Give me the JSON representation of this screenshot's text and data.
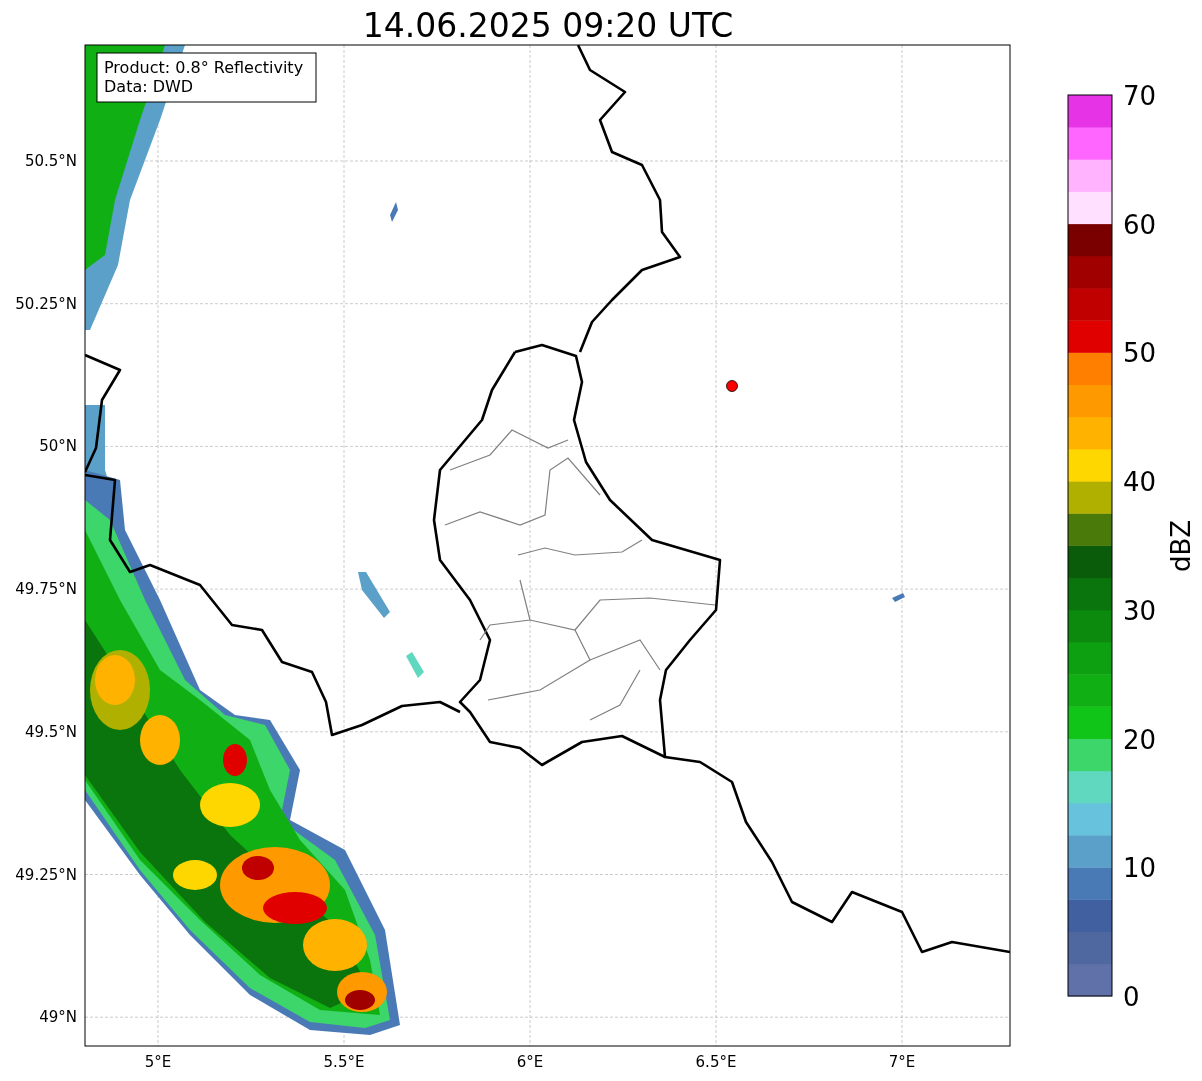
{
  "title": "14.06.2025 09:20 UTC",
  "annotation": [
    "Product: 0.8° Reflectivity",
    "Data: DWD"
  ],
  "y_ticks": [
    "50.5°N",
    "50.25°N",
    "50°N",
    "49.75°N",
    "49.5°N",
    "49.25°N",
    "49°N"
  ],
  "x_ticks": [
    "5°E",
    "5.5°E",
    "6°E",
    "6.5°E",
    "7°E"
  ],
  "colorbar": {
    "label": "dBZ",
    "ticks": [
      "70",
      "60",
      "50",
      "40",
      "30",
      "20",
      "10",
      "0"
    ],
    "bands": [
      {
        "color": "#6070a8"
      },
      {
        "color": "#5068a0"
      },
      {
        "color": "#4060a0"
      },
      {
        "color": "#4a7ab5"
      },
      {
        "color": "#5aa0c8"
      },
      {
        "color": "#66c2dd"
      },
      {
        "color": "#60d8c0"
      },
      {
        "color": "#3dd66b"
      },
      {
        "color": "#10c418"
      },
      {
        "color": "#10b014"
      },
      {
        "color": "#0da010"
      },
      {
        "color": "#0b8a0e"
      },
      {
        "color": "#0a750c"
      },
      {
        "color": "#0a5c0a"
      },
      {
        "color": "#4a7a0a"
      },
      {
        "color": "#b0b000"
      },
      {
        "color": "#ffd700"
      },
      {
        "color": "#ffb300"
      },
      {
        "color": "#ff9900"
      },
      {
        "color": "#ff8000"
      },
      {
        "color": "#e00000"
      },
      {
        "color": "#c00000"
      },
      {
        "color": "#a00000"
      },
      {
        "color": "#7a0000"
      },
      {
        "color": "#ffe0ff"
      },
      {
        "color": "#ffb3ff"
      },
      {
        "color": "#ff66ff"
      },
      {
        "color": "#e633e6"
      }
    ]
  }
}
